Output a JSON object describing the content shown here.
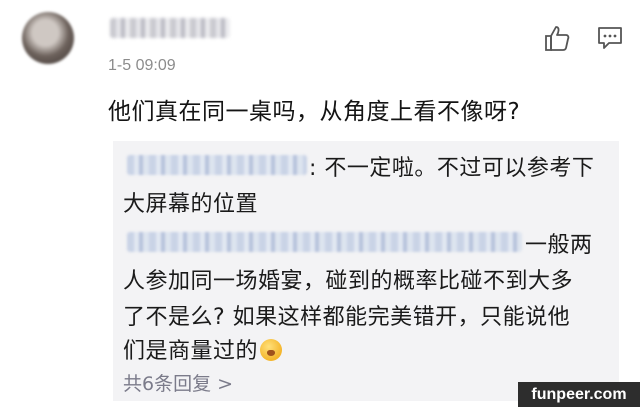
{
  "post": {
    "timestamp": "1-5 09:09",
    "comment": "他们真在同一桌吗，从角度上看不像呀?"
  },
  "icons": {
    "like": "thumbs-up-icon",
    "comment": "comment-bubble-icon"
  },
  "replies": {
    "reply1_line1": ": 不一定啦。不过可以参考下",
    "reply1_line2": "大屏幕的位置",
    "reply2_line1": "一般两",
    "reply2_line2": "人参加同一场婚宴，碰到的概率比碰不到大多",
    "reply2_line3": "了不是么? 如果这样都能完美错开，只能说他",
    "reply2_line4": "们是商量过的",
    "more_label": "共6条回复 >"
  },
  "watermark": "funpeer.com",
  "colors": {
    "reply_background": "#f3f3f5",
    "timestamp": "#8c8c8c",
    "more_replies": "#7b7b8a"
  }
}
